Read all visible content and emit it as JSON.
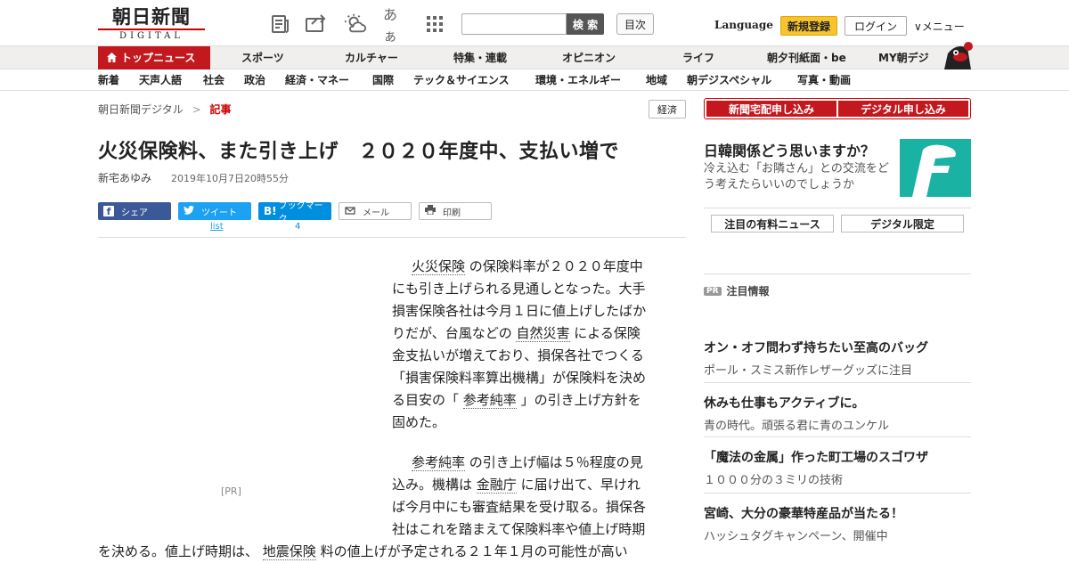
{
  "header": {
    "logo_ja": "朝日新聞",
    "logo_en": "DIGITAL",
    "icons": [
      "newspaper-icon",
      "share-icon",
      "weather-icon",
      "font-size-icon",
      "apps-grid-icon"
    ],
    "font_size_glyph": "あぁ",
    "search_button": "検 索",
    "mokuji": "目次",
    "language": "Language",
    "register": "新規登録",
    "login": "ログイン",
    "menu": "メニュー"
  },
  "nav1": [
    "トップニュース",
    "スポーツ",
    "カルチャー",
    "特集・連載",
    "オピニオン",
    "ライフ",
    "朝夕刊紙面・be",
    "MY朝デジ"
  ],
  "nav2": [
    "新着",
    "天声人語",
    "社会",
    "政治",
    "経済・マネー",
    "国際",
    "テック＆サイエンス",
    "環境・エネルギー",
    "地域",
    "朝デジスペシャル",
    "写真・動画"
  ],
  "breadcrumb": {
    "home": "朝日新聞デジタル",
    "sep": ">",
    "current": "記事"
  },
  "tag": "経済",
  "article": {
    "title": "火災保険料、また引き上げ　２０２０年度中、支払い増で",
    "author": "新宅あゆみ",
    "date": "2019年10月7日20時55分",
    "share": {
      "facebook": "シェア",
      "twitter": "ツイート",
      "twitter_count": "list",
      "hatena": "ブックマーク",
      "hatena_count": "4",
      "mail": "メール",
      "print": "印刷"
    },
    "pr": "[PR]",
    "p1": {
      "l1a": "火災保険",
      "l1b": "の保険料率が２０２０年度中",
      "l2": "にも引き上げられる見通しとなった。大手",
      "l3": "損害保険各社は今月１日に値上げしたばか",
      "l4a": "りだが、台風などの",
      "l4b": "自然災害",
      "l4c": "による保険",
      "l5": "金支払いが増えており、損保各社でつくる",
      "l6": "「損害保険料率算出機構」が保険料を決め",
      "l7a": "る目安の「",
      "l7b": "参考純率",
      "l7c": "」の引き上げ方針を",
      "l8": "固めた。"
    },
    "p2": {
      "l1a": "参考純率",
      "l1b": "の引き上げ幅は５％程度の見",
      "l2a": "込み。機構は",
      "l2b": "金融庁",
      "l2c": "に届け出て、早けれ",
      "l3": "ば今月中にも審査結果を受け取る。損保各",
      "l4": "社はこれを踏まえて保険料率や値上げ時期",
      "l5a": "を決める。値上げ時期は、",
      "l5b": "地震保険",
      "l5c": "料の値上げが予定される２１年１月の可能性が高い"
    }
  },
  "sidebar": {
    "btn_newspaper": "新聞宅配申し込み",
    "btn_digital": "デジタル申し込み",
    "feature_title": "日韓関係どう思いますか？",
    "feature_text": "冷え込む「お隣さん」との交流をどう考えたらいいのでしょうか",
    "box1": "注目の有料ニュース",
    "box2": "デジタル限定",
    "pr_badge": "PR",
    "pr_label": "注目情報",
    "items": [
      {
        "title": "オン・オフ問わず持ちたい至高のバッグ",
        "desc": "ポール・スミス新作レザーグッズに注目"
      },
      {
        "title": "休みも仕事もアクティブに。",
        "desc": "青の時代。頑張る君に青のユンケル"
      },
      {
        "title": "「魔法の金属」作った町工場のスゴワザ",
        "desc": "１０００分の３ミリの技術"
      },
      {
        "title": "宮崎、大分の豪華特産品が当たる！",
        "desc": "ハッシュタグキャンペーン、開催中"
      }
    ]
  },
  "colors": {
    "brand_red": "#c3181e",
    "register_yellow": "#f7c32e",
    "facebook": "#3b5998",
    "twitter": "#1da1f2",
    "hatena": "#008fde",
    "teal": "#1ab3a3"
  }
}
